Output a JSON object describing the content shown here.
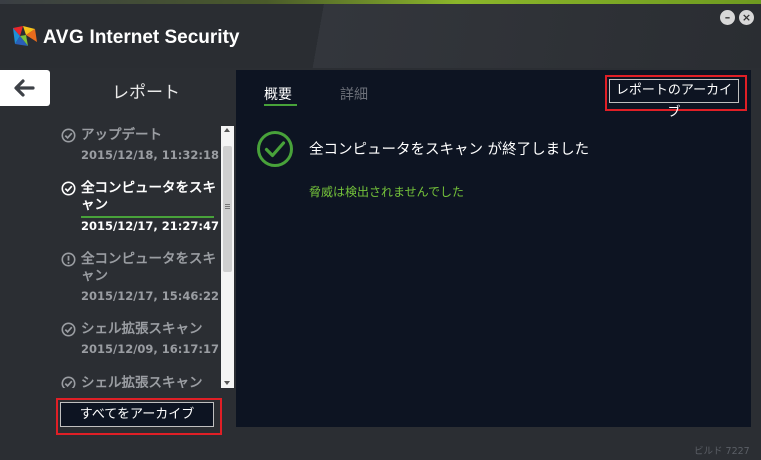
{
  "app": {
    "brand": "AVG",
    "product": "Internet Security",
    "build": "ビルド 7227"
  },
  "window_controls": {
    "minimize": "–",
    "close": "×"
  },
  "left": {
    "title": "レポート",
    "items": [
      {
        "label": "アップデート",
        "date": "2015/12/18, 11:32:18",
        "status": "ok"
      },
      {
        "label": "全コンピュータをスキャン",
        "date": "2015/12/17, 21:27:47",
        "status": "ok",
        "selected": true
      },
      {
        "label": "全コンピュータをスキャン",
        "date": "2015/12/17, 15:46:22",
        "status": "warning"
      },
      {
        "label": "シェル拡張スキャン",
        "date": "2015/12/09, 16:17:17",
        "status": "ok"
      },
      {
        "label": "シェル拡張スキャン",
        "status": "ok"
      }
    ],
    "archive_all": "すべてをアーカイブ"
  },
  "panel": {
    "tabs": {
      "overview": "概要",
      "details": "詳細"
    },
    "archive_report": "レポートのアーカイブ",
    "result_title": "全コンピュータをスキャン が終了しました",
    "result_sub": "脅威は検出されませんでした"
  },
  "colors": {
    "accent_green": "#48a23a",
    "highlight_red": "#e01f26",
    "panel_bg": "#0d1422",
    "window_bg": "#2b2e33"
  }
}
